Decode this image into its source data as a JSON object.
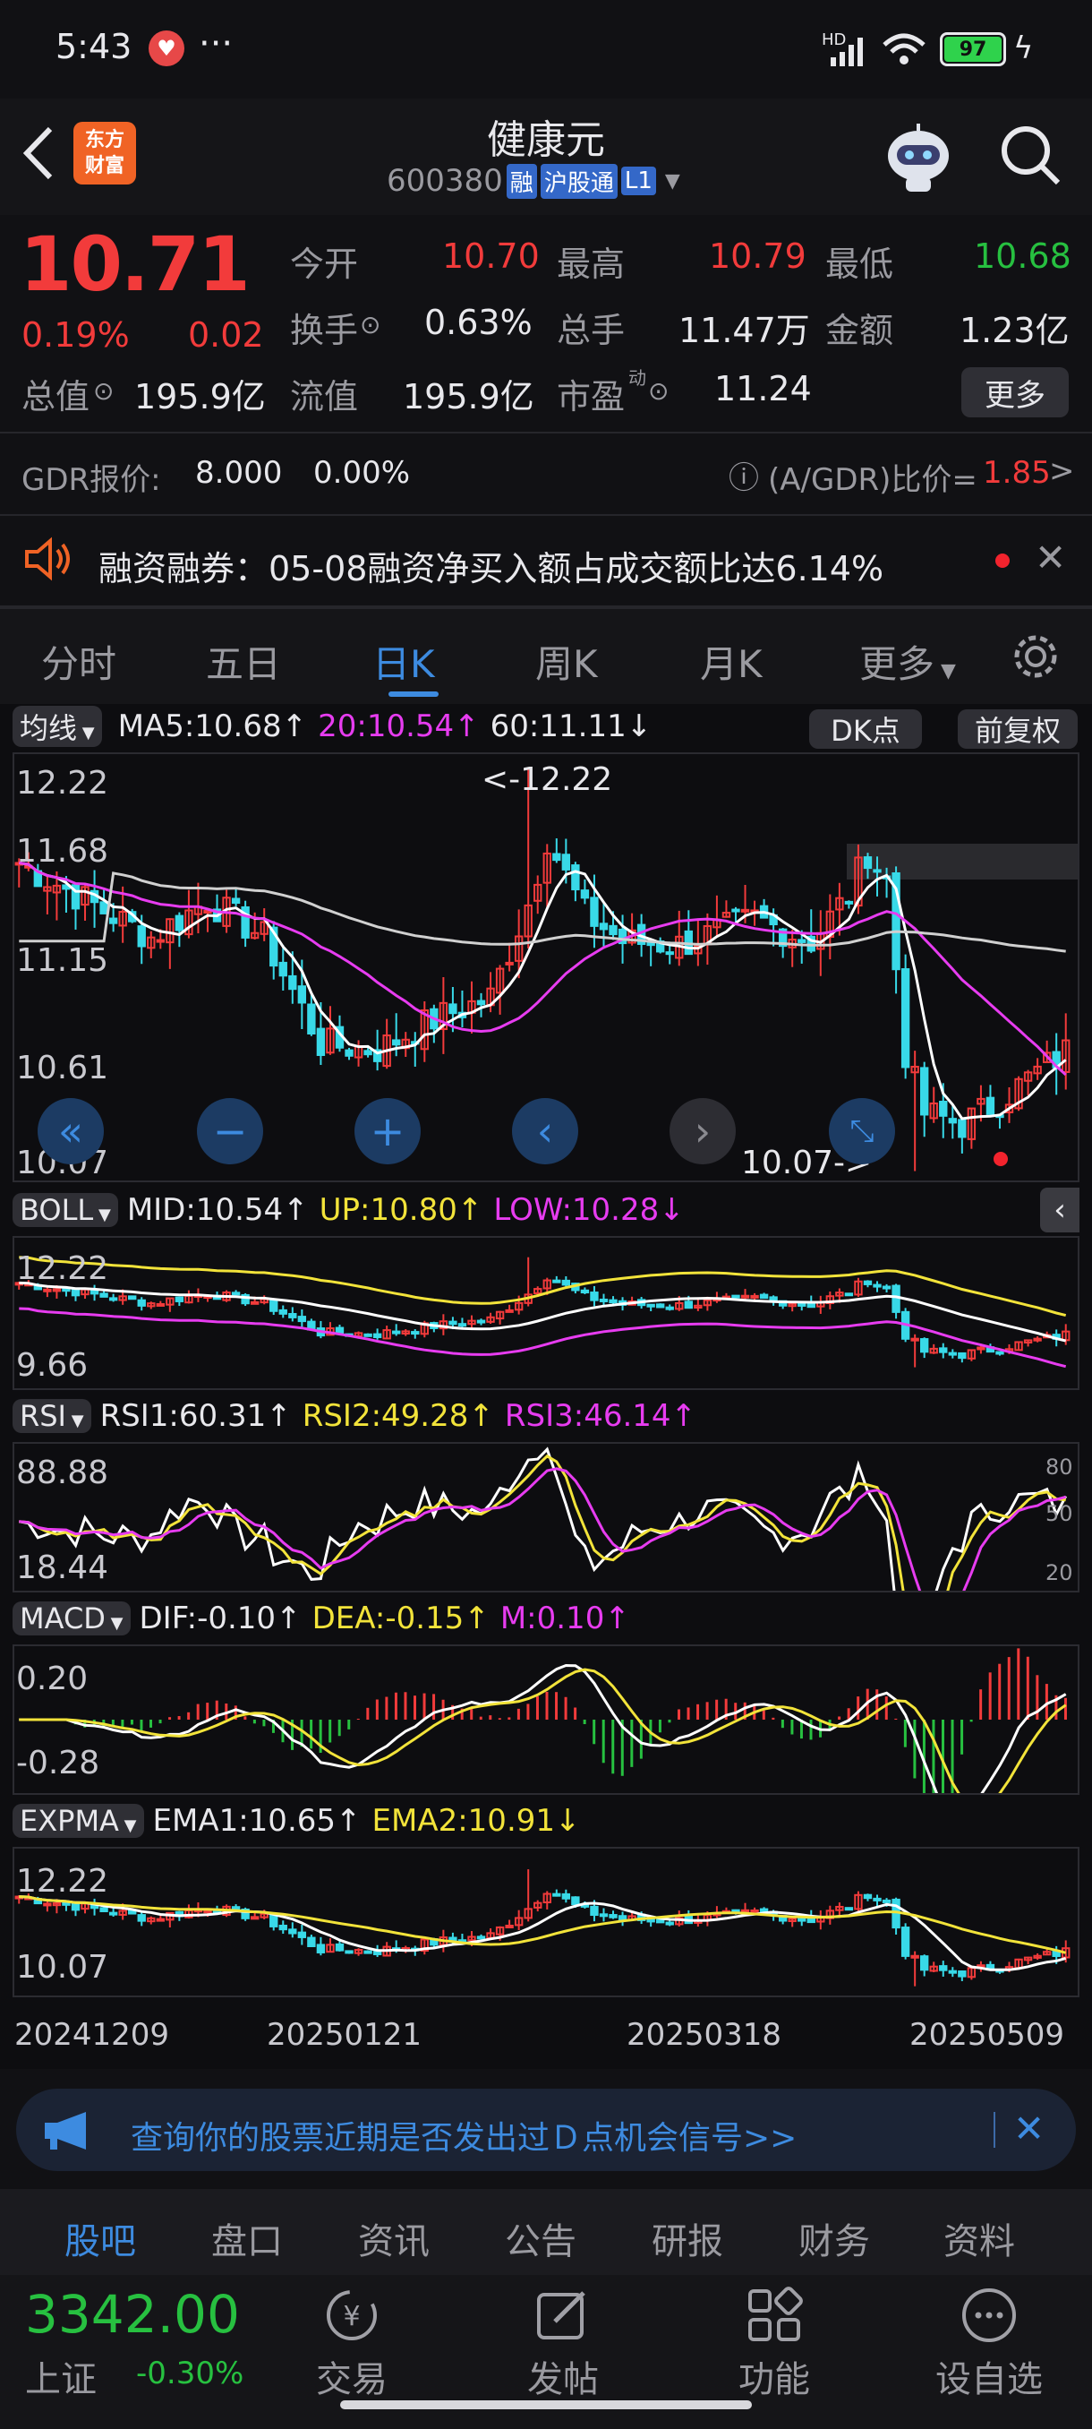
{
  "status_bar": {
    "time": "5:43",
    "dots": "···",
    "battery": "97",
    "network": "HD"
  },
  "header": {
    "title": "健康元",
    "code": "600380",
    "tag_rong": "融",
    "tag_hgt": "沪股通",
    "tag_l1": "L1",
    "logo_line1": "东方",
    "logo_line2": "财富"
  },
  "quote": {
    "price": "10.71",
    "change_pct": "0.19%",
    "change": "0.02",
    "open_label": "今开",
    "open": "10.70",
    "high_label": "最高",
    "high": "10.79",
    "low_label": "最低",
    "low": "10.68",
    "turnover_label": "换手",
    "turnover": "0.63%",
    "volume_label": "总手",
    "volume": "11.47万",
    "amount_label": "金额",
    "amount": "1.23亿",
    "mktcap_label": "总值",
    "mktcap": "195.9亿",
    "float_label": "流值",
    "float": "195.9亿",
    "pe_label": "市盈",
    "pe_sup": "动",
    "pe": "11.24",
    "more_label": "更多"
  },
  "gdr": {
    "label": "GDR报价:",
    "price": "8.000",
    "pct": "0.00%",
    "ratio_label": "(A/GDR)比价=",
    "ratio": "1.85"
  },
  "notice": {
    "text": "融资融券：05-08融资净买入额占成交额比达6.14%"
  },
  "tabs": [
    "分时",
    "五日",
    "日K",
    "周K",
    "月K",
    "更多"
  ],
  "active_tab": "日K",
  "main_chart": {
    "ma_type": "均线",
    "ma5": "MA5:10.68",
    "ma20": "20:10.54",
    "ma60": "60:11.11",
    "dk": "DK点",
    "fq": "前复权",
    "y_labels": [
      "12.22",
      "11.68",
      "11.15",
      "10.61",
      "10.07"
    ],
    "max_label": "<-12.22",
    "min_label": "10.07->"
  },
  "boll": {
    "name": "BOLL",
    "mid": "MID:10.54",
    "up": "UP:10.80",
    "low": "LOW:10.28",
    "y_top": "12.22",
    "y_bottom": "9.66"
  },
  "rsi": {
    "name": "RSI",
    "rsi1": "RSI1:60.31",
    "rsi2": "RSI2:49.28",
    "rsi3": "RSI3:46.14",
    "y_top": "88.88",
    "y_bottom": "18.44",
    "r80": "80",
    "r50": "50",
    "r20": "20"
  },
  "macd": {
    "name": "MACD",
    "dif": "DIF:-0.10",
    "dea": "DEA:-0.15",
    "m": "M:0.10",
    "y_top": "0.20",
    "y_bottom": "-0.28"
  },
  "expma": {
    "name": "EXPMA",
    "ema1": "EMA1:10.65",
    "ema2": "EMA2:10.91",
    "y_top": "12.22",
    "y_bottom": "10.07"
  },
  "x_dates": [
    "20241209",
    "20250121",
    "20250318",
    "20250509"
  ],
  "banner": {
    "text": "查询你的股票近期是否发出过Ｄ点机会信号>>"
  },
  "subtabs": [
    "股吧",
    "盘口",
    "资讯",
    "公告",
    "研报",
    "财务",
    "资料"
  ],
  "active_subtab": "股吧",
  "bottom": {
    "index_value": "3342.00",
    "index_name": "上证",
    "index_pct": "-0.30%",
    "trade": "交易",
    "post": "发帖",
    "func": "功能",
    "watch": "设自选"
  },
  "colors": {
    "up": "#f23b3b",
    "down": "#27c040",
    "accent": "#3d8be0",
    "ma20": "#e73cf0",
    "ma60": "#d0d0d0",
    "yellow": "#f2e33a",
    "candle_down": "#38d9e8"
  }
}
